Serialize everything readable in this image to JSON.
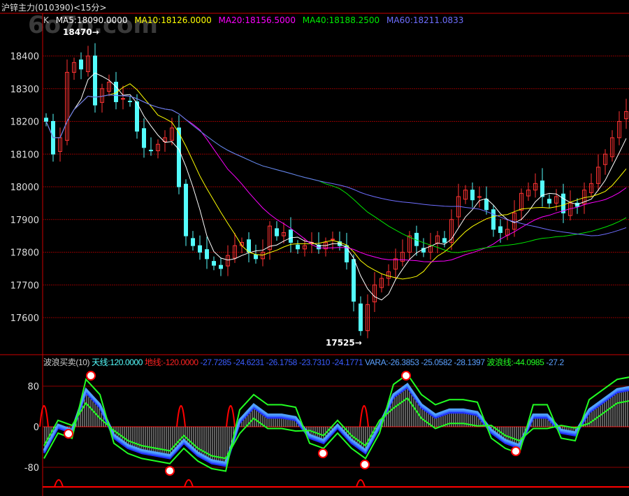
{
  "header": {
    "title": "沪锌主力(010390)<15分>",
    "watermark": "6o7o.com"
  },
  "main_legend": {
    "k": "K",
    "ma5": "MA5:18090.0000",
    "ma10": "MA10:18126.0000",
    "ma20": "MA20:18156.5000",
    "ma40": "MA40:18188.2500",
    "ma60": "MA60:18211.0833"
  },
  "sub_legend": {
    "name": "波浪买卖(10)",
    "tian": "天线:120.0000",
    "di": "地线:-120.0000",
    "vals": "-27.7285 -24.6231 -26.1758 -23.7310 -24.1771",
    "vara": "VARA:-26.3853 -25.0582 -28.1397",
    "wave": "波浪线:-44.0985",
    "wave_more": "-27.2"
  },
  "colors": {
    "up": "#ff3232",
    "down": "#54fcfc",
    "ma5": "#ffffff",
    "ma10": "#ffff00",
    "ma20": "#ff00ff",
    "ma40": "#00e600",
    "ma60": "#6e6eff",
    "grid": "#8b0000"
  },
  "chart_data": [
    {
      "type": "candlestick",
      "title": "沪锌主力(010390)<15分>",
      "ylim": [
        17500,
        18480
      ],
      "yticks": [
        18400,
        18300,
        18200,
        18100,
        18000,
        17900,
        17800,
        17700,
        17600
      ],
      "annotations": [
        {
          "text": "18470",
          "value": 18470
        },
        {
          "text": "17525",
          "value": 17525
        }
      ],
      "closes": [
        18200,
        18100,
        18150,
        18350,
        18380,
        18360,
        18400,
        18250,
        18300,
        18320,
        18260,
        18270,
        18260,
        18170,
        18120,
        18110,
        18130,
        18150,
        18180,
        18000,
        17850,
        17820,
        17800,
        17780,
        17760,
        17750,
        17790,
        17820,
        17830,
        17800,
        17780,
        17800,
        17880,
        17850,
        17860,
        17830,
        17810,
        17820,
        17830,
        17810,
        17830,
        17840,
        17820,
        17770,
        17650,
        17560,
        17640,
        17700,
        17720,
        17740,
        17780,
        17800,
        17850,
        17820,
        17800,
        17820,
        17850,
        17830,
        17900,
        17970,
        17990,
        17960,
        17970,
        17930,
        17870,
        17860,
        17870,
        17920,
        17980,
        17990,
        18010,
        17970,
        17950,
        17970,
        17920,
        17950,
        17940,
        17990,
        18010,
        18060,
        18100,
        18150,
        18200,
        18230
      ]
    },
    {
      "type": "line",
      "title": "波浪买卖(10)",
      "ylim": [
        -120,
        120
      ],
      "yticks": [
        80,
        0,
        -80
      ],
      "wave": [
        -50,
        0,
        -10,
        70,
        40,
        -20,
        -40,
        -50,
        -55,
        -60,
        -30,
        -55,
        -70,
        -75,
        10,
        40,
        20,
        20,
        15,
        -20,
        -30,
        0,
        -30,
        -50,
        0,
        60,
        80,
        40,
        20,
        30,
        30,
        25,
        -10,
        -30,
        -40,
        20,
        20,
        -10,
        -15,
        30,
        50,
        70,
        75
      ]
    }
  ]
}
